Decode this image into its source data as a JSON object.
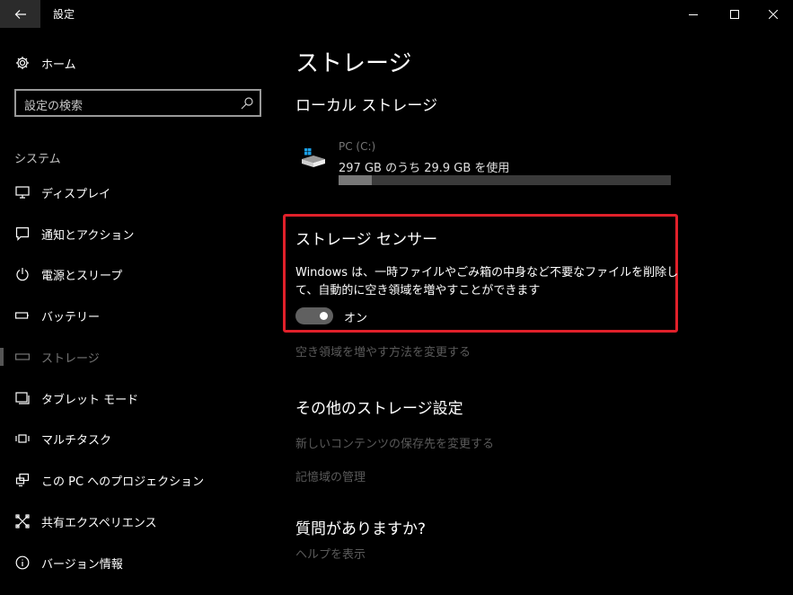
{
  "window": {
    "title": "設定"
  },
  "sidebar": {
    "home_label": "ホーム",
    "search_placeholder": "設定の検索",
    "section_label": "システム",
    "items": [
      {
        "label": "ディスプレイ",
        "icon": "display-icon"
      },
      {
        "label": "通知とアクション",
        "icon": "notification-icon"
      },
      {
        "label": "電源とスリープ",
        "icon": "power-icon"
      },
      {
        "label": "バッテリー",
        "icon": "battery-icon"
      },
      {
        "label": "ストレージ",
        "icon": "storage-icon",
        "selected": true
      },
      {
        "label": "タブレット モード",
        "icon": "tablet-mode-icon"
      },
      {
        "label": "マルチタスク",
        "icon": "multitasking-icon"
      },
      {
        "label": "この PC へのプロジェクション",
        "icon": "projection-icon"
      },
      {
        "label": "共有エクスペリエンス",
        "icon": "shared-experiences-icon"
      },
      {
        "label": "バージョン情報",
        "icon": "info-icon"
      }
    ]
  },
  "main": {
    "title": "ストレージ",
    "local_storage": {
      "heading": "ローカル ストレージ",
      "drive_name": "PC (C:)",
      "drive_usage": "297 GB のうち 29.9 GB を使用",
      "used_fraction": 0.1
    },
    "storage_sense": {
      "heading": "ストレージ センサー",
      "description": "Windows は、一時ファイルやごみ箱の中身など不要なファイルを削除して、自動的に空き領域を増やすことができます",
      "toggle_state": "オン",
      "highlight_color": "#e0202a"
    },
    "free_space_link": "空き領域を増やす方法を変更する",
    "more_settings": {
      "heading": "その他のストレージ設定",
      "links": [
        "新しいコンテンツの保存先を変更する",
        "記憶域の管理"
      ]
    },
    "question": {
      "heading": "質問がありますか?",
      "link": "ヘルプを表示"
    }
  }
}
